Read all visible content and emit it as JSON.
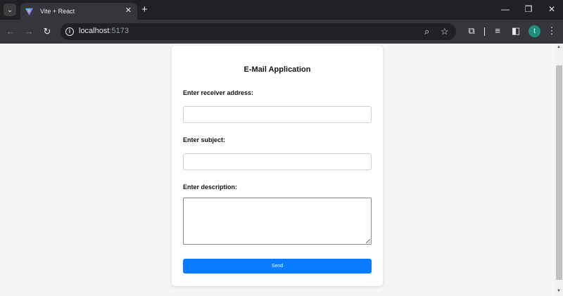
{
  "browser": {
    "tab": {
      "title": "Vite + React",
      "close_glyph": "✕"
    },
    "tab_search_glyph": "⌄",
    "new_tab_glyph": "+",
    "window_controls": {
      "minimize": "—",
      "restore": "❐",
      "close": "✕"
    },
    "nav": {
      "back": "←",
      "forward": "→",
      "reload": "↻"
    },
    "address": {
      "host": "localhost",
      "port": ":5173"
    },
    "omnibox_icons": {
      "zoom": "⌕",
      "bookmark": "☆"
    },
    "toolbar_icons": {
      "extensions": "⧉",
      "media": "≡",
      "side_panel": "◧",
      "menu": "⋮"
    },
    "profile_initial": "t",
    "colors": {
      "profile": "#1e8e7e"
    }
  },
  "form": {
    "title": "E-Mail Application",
    "receiver_label": "Enter receiver address:",
    "receiver_value": "",
    "subject_label": "Enter subject:",
    "subject_value": "",
    "description_label": "Enter description:",
    "description_value": "",
    "send_label": "Send",
    "colors": {
      "send_button": "#0a7cff"
    }
  },
  "scrollbar": {
    "up_glyph": "▲",
    "down_glyph": "▼"
  }
}
